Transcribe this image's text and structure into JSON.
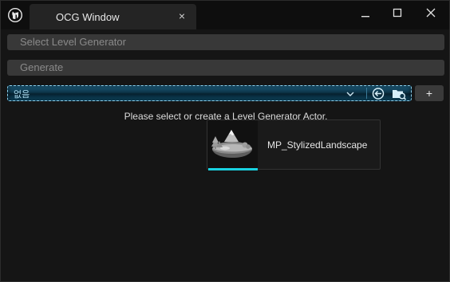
{
  "window": {
    "tab_title": "OCG Window",
    "tab_close_glyph": "×"
  },
  "fields": {
    "select_level_generator_placeholder": "Select Level Generator",
    "generate_label": "Generate"
  },
  "selector": {
    "value": "없음",
    "add_label": "+"
  },
  "message": "Please select or create a Level Generator Actor.",
  "asset": {
    "name": "MP_StylizedLandscape",
    "icon": "landscape-icon"
  },
  "colors": {
    "accent": "#19d2e0",
    "selector_border": "#8fd3f0",
    "background": "#151515",
    "field": "#383838"
  }
}
